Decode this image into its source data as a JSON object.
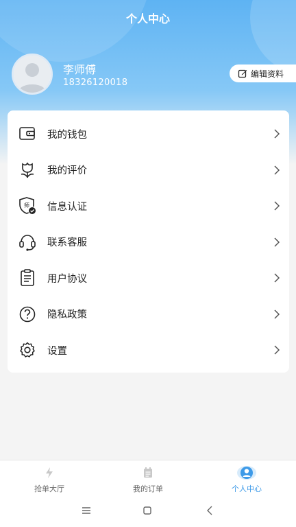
{
  "header": {
    "title": "个人中心"
  },
  "profile": {
    "name": "李师傅",
    "phone": "18326120018",
    "edit_label": "编辑资料"
  },
  "menu": {
    "items": [
      {
        "label": "我的钱包",
        "icon": "wallet-icon"
      },
      {
        "label": "我的评价",
        "icon": "flower-icon"
      },
      {
        "label": "信息认证",
        "icon": "shield-badge-icon"
      },
      {
        "label": "联系客服",
        "icon": "headset-icon"
      },
      {
        "label": "用户协议",
        "icon": "clipboard-icon"
      },
      {
        "label": "隐私政策",
        "icon": "question-circle-icon"
      },
      {
        "label": "设置",
        "icon": "gear-icon"
      }
    ]
  },
  "tabbar": {
    "tabs": [
      {
        "label": "抢单大厅",
        "icon": "lightning-icon",
        "active": false
      },
      {
        "label": "我的订单",
        "icon": "calendar-icon",
        "active": false
      },
      {
        "label": "个人中心",
        "icon": "person-icon",
        "active": true
      }
    ]
  },
  "colors": {
    "header_blue": "#5eb3f3",
    "active_tab": "#3d9ae8"
  }
}
